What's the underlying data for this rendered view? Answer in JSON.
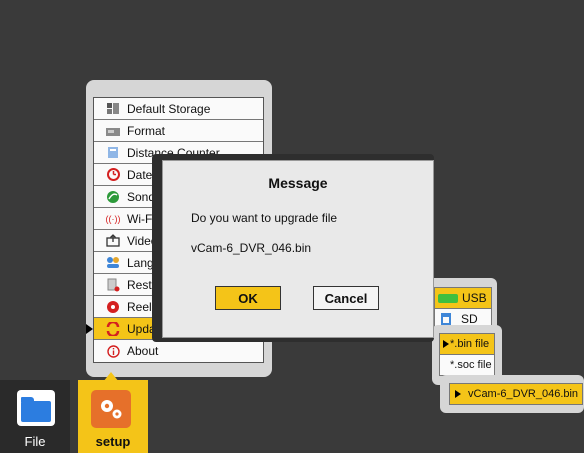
{
  "setup_menu": {
    "items": [
      {
        "label": "Default Storage",
        "icon": "storage-icon"
      },
      {
        "label": "Format",
        "icon": "format-icon"
      },
      {
        "label": "Distance Counter",
        "icon": "distance-counter-icon"
      },
      {
        "label": "Date/T",
        "icon": "clock-icon"
      },
      {
        "label": "Sonde",
        "icon": "sonde-icon"
      },
      {
        "label": "Wi-Fi",
        "icon": "wifi-icon"
      },
      {
        "label": "Video",
        "icon": "video-icon"
      },
      {
        "label": "Langu",
        "icon": "language-icon"
      },
      {
        "label": "Resto",
        "icon": "restore-icon"
      },
      {
        "label": "Reel S",
        "icon": "reel-icon"
      },
      {
        "label": "Updat",
        "icon": "update-icon",
        "selected": true
      },
      {
        "label": "About",
        "icon": "info-icon"
      }
    ]
  },
  "storage_menu": {
    "items": [
      {
        "label": "USB",
        "icon": "usb-icon",
        "selected": true
      },
      {
        "label": "SD",
        "icon": "sd-icon"
      }
    ]
  },
  "file_type_menu": {
    "items": [
      {
        "label": "*.bin file",
        "selected": true
      },
      {
        "label": "*.soc file"
      }
    ]
  },
  "file_list": {
    "items": [
      {
        "label": "vCam-6_DVR_046.bin",
        "selected": true
      }
    ]
  },
  "dialog": {
    "title": "Message",
    "line1": "Do you want to upgrade file",
    "line2": "vCam-6_DVR_046.bin",
    "ok_label": "OK",
    "cancel_label": "Cancel"
  },
  "bottom_bar": {
    "file_label": "File",
    "setup_label": "setup"
  },
  "colors": {
    "background": "#3a3a3a",
    "accent": "#f4c418",
    "panel": "#d6d6d6",
    "dialog": "#e9e9e9"
  }
}
